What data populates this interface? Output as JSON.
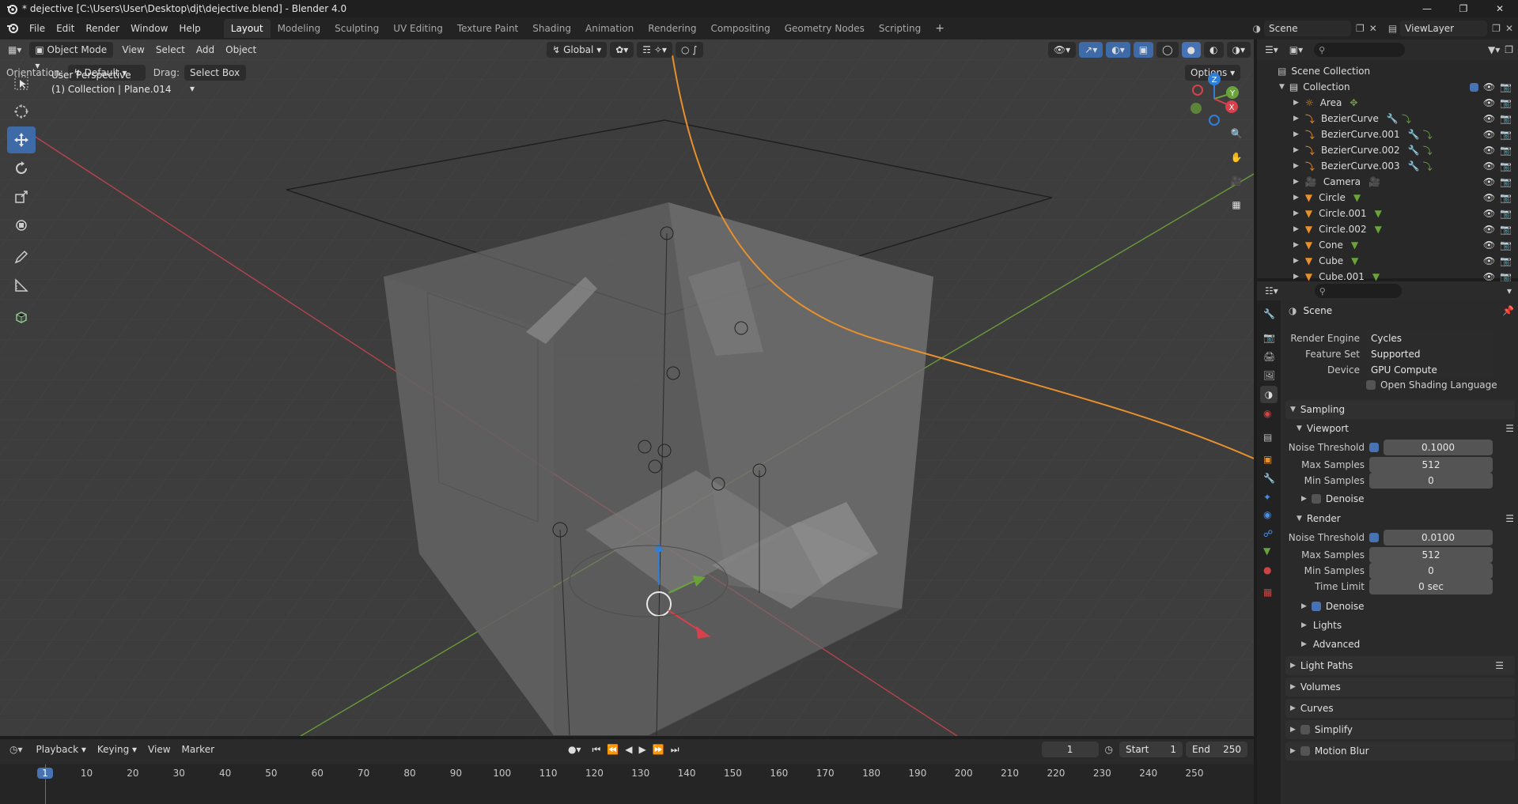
{
  "window": {
    "title": "* dejective [C:\\Users\\User\\Desktop\\djt\\dejective.blend] - Blender 4.0"
  },
  "menus": [
    "File",
    "Edit",
    "Render",
    "Window",
    "Help"
  ],
  "workspaces": [
    {
      "label": "Layout",
      "active": true
    },
    {
      "label": "Modeling",
      "active": false
    },
    {
      "label": "Sculpting",
      "active": false
    },
    {
      "label": "UV Editing",
      "active": false
    },
    {
      "label": "Texture Paint",
      "active": false
    },
    {
      "label": "Shading",
      "active": false
    },
    {
      "label": "Animation",
      "active": false
    },
    {
      "label": "Rendering",
      "active": false
    },
    {
      "label": "Compositing",
      "active": false
    },
    {
      "label": "Geometry Nodes",
      "active": false
    },
    {
      "label": "Scripting",
      "active": false
    }
  ],
  "scene_selector": {
    "value": "Scene"
  },
  "viewlayer_selector": {
    "value": "ViewLayer"
  },
  "viewport": {
    "mode": "Object Mode",
    "menu": [
      "View",
      "Select",
      "Add",
      "Object"
    ],
    "transform_orientation": "Global",
    "orientation_label": "Orientation:",
    "orientation_value": "Default",
    "drag_label": "Drag:",
    "drag_value": "Select Box",
    "options_label": "Options",
    "overlay_line1": "User Perspective",
    "overlay_line2": "(1) Collection | Plane.014",
    "gizmo_axes": [
      "X",
      "Y",
      "Z"
    ]
  },
  "outliner": {
    "root": "Scene Collection",
    "collection": "Collection",
    "items": [
      {
        "name": "Area",
        "type": "light"
      },
      {
        "name": "BezierCurve",
        "type": "curve"
      },
      {
        "name": "BezierCurve.001",
        "type": "curve"
      },
      {
        "name": "BezierCurve.002",
        "type": "curve"
      },
      {
        "name": "BezierCurve.003",
        "type": "curve"
      },
      {
        "name": "Camera",
        "type": "camera"
      },
      {
        "name": "Circle",
        "type": "mesh"
      },
      {
        "name": "Circle.001",
        "type": "mesh"
      },
      {
        "name": "Circle.002",
        "type": "mesh"
      },
      {
        "name": "Cone",
        "type": "mesh"
      },
      {
        "name": "Cube",
        "type": "mesh"
      },
      {
        "name": "Cube.001",
        "type": "mesh"
      }
    ]
  },
  "properties": {
    "context": "Scene",
    "render_engine_label": "Render Engine",
    "render_engine": "Cycles",
    "feature_set_label": "Feature Set",
    "feature_set": "Supported",
    "device_label": "Device",
    "device": "GPU Compute",
    "osl_label": "Open Shading Language",
    "sampling": "Sampling",
    "viewport_sub": "Viewport",
    "render_sub": "Render",
    "noise_threshold_label": "Noise Threshold",
    "max_samples_label": "Max Samples",
    "min_samples_label": "Min Samples",
    "time_limit_label": "Time Limit",
    "denoise_label": "Denoise",
    "viewport_noise_threshold": "0.1000",
    "viewport_max_samples": "512",
    "viewport_min_samples": "0",
    "render_noise_threshold": "0.0100",
    "render_max_samples": "512",
    "render_min_samples": "0",
    "render_time_limit": "0 sec",
    "lights": "Lights",
    "advanced": "Advanced",
    "light_paths": "Light Paths",
    "volumes": "Volumes",
    "curves": "Curves",
    "simplify": "Simplify",
    "motion_blur": "Motion Blur"
  },
  "timeline": {
    "menu": [
      "Playback",
      "Keying",
      "View",
      "Marker"
    ],
    "current_frame": "1",
    "start_label": "Start",
    "start": "1",
    "end_label": "End",
    "end": "250",
    "ruler": [
      "1",
      "10",
      "20",
      "30",
      "40",
      "50",
      "60",
      "70",
      "80",
      "90",
      "100",
      "110",
      "120",
      "130",
      "140",
      "150",
      "160",
      "170",
      "180",
      "190",
      "200",
      "210",
      "220",
      "230",
      "240",
      "250"
    ]
  },
  "colors": {
    "accent": "#4772b3",
    "x_axis": "#d8404c",
    "y_axis": "#6aa33a",
    "z_axis": "#2f7fd8",
    "curve": "#e8902c"
  }
}
